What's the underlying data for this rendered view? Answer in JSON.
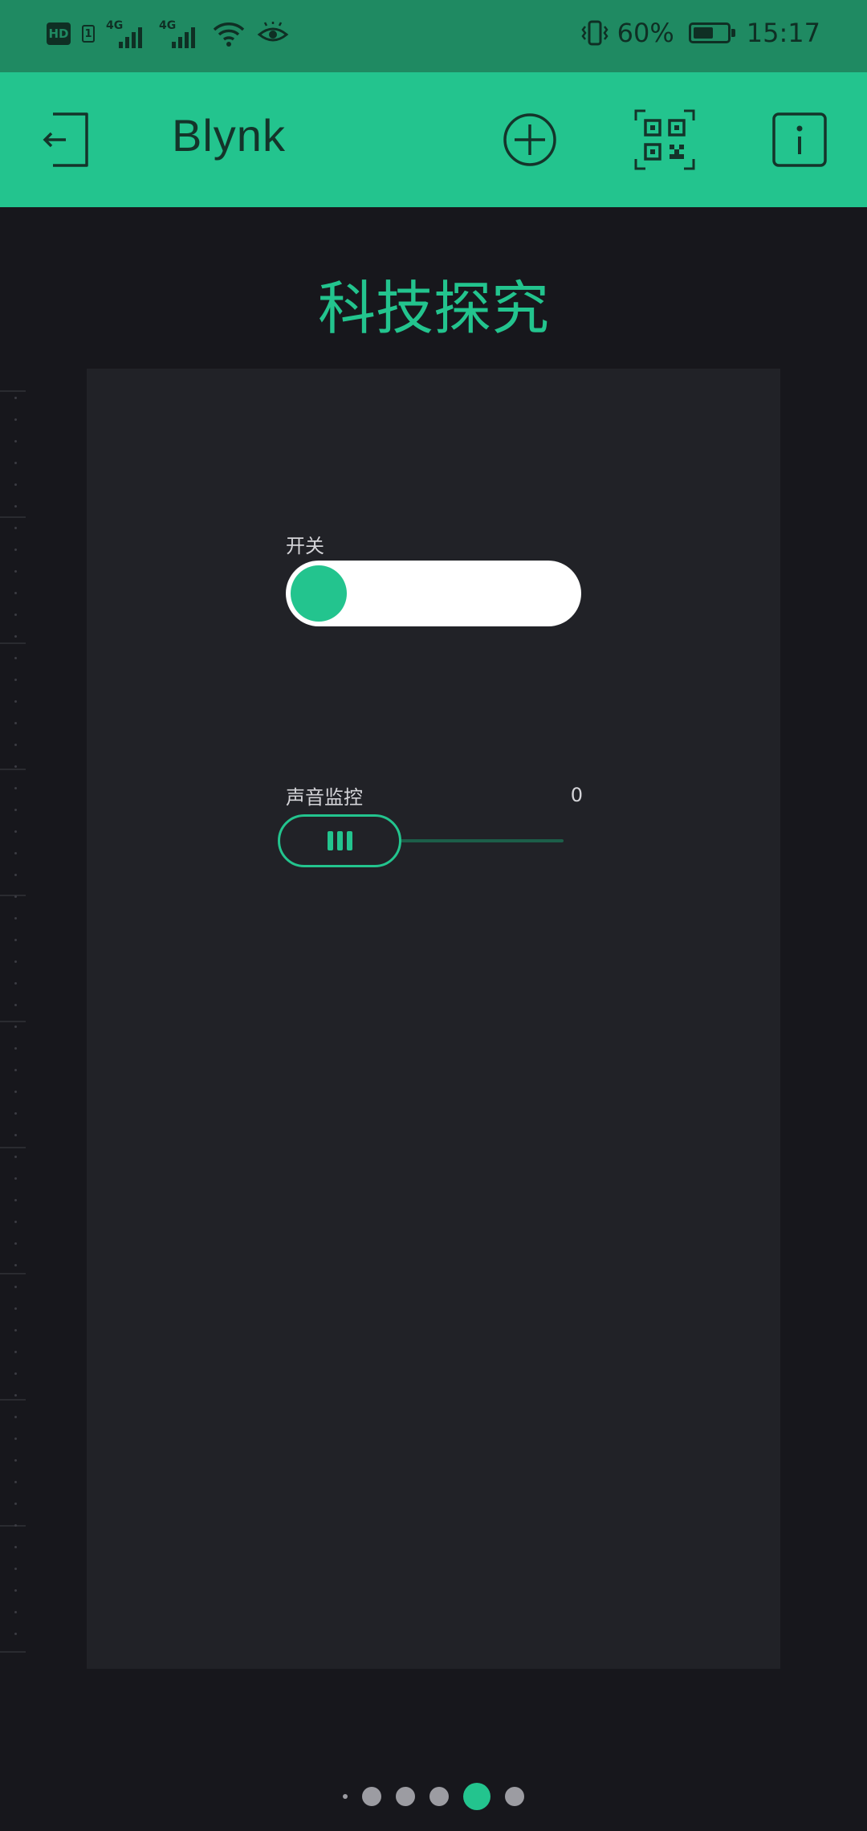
{
  "status_bar": {
    "hd_label": "HD",
    "sim_label": "1",
    "network_1": "4G",
    "network_2": "4G",
    "battery_percent": "60%",
    "battery_level": 0.6,
    "time": "15:17"
  },
  "app_bar": {
    "title": "Blynk",
    "icons": [
      "exit-icon",
      "add-circle-icon",
      "qr-code-icon",
      "info-icon"
    ]
  },
  "project": {
    "title": "科技探究"
  },
  "widgets": {
    "switch": {
      "label": "开关",
      "state": "off"
    },
    "slider": {
      "label": "声音监控",
      "value": "0"
    }
  },
  "pager": {
    "page_count": 6,
    "active_index": 4
  },
  "colors": {
    "accent": "#23c48e",
    "status_bar": "#1f8a62",
    "background": "#17171c",
    "canvas": "#212227"
  }
}
